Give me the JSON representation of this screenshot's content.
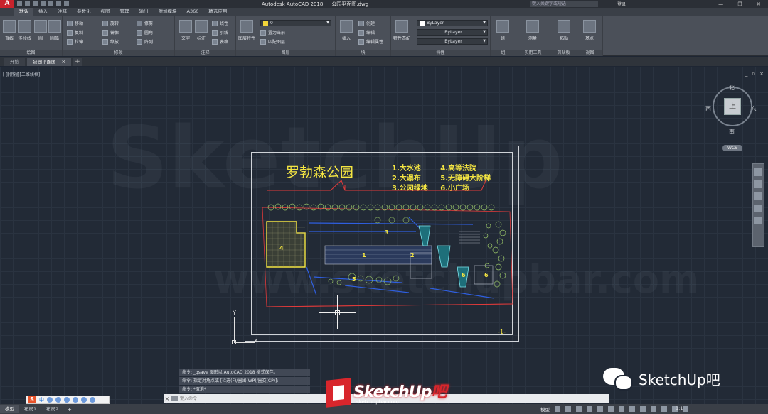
{
  "titlebar": {
    "app_icon": "A",
    "app_name": "Autodesk AutoCAD 2018",
    "file_name": "公园平面图.dwg",
    "search_placeholder": "键入关键字或短语",
    "signin": "登录"
  },
  "ribbon_tabs": [
    "默认",
    "插入",
    "注释",
    "参数化",
    "视图",
    "管理",
    "输出",
    "附加模块",
    "A360",
    "精选应用"
  ],
  "ribbon": {
    "draw": {
      "title": "绘图",
      "line": "直线",
      "polyline": "多段线",
      "circle": "圆",
      "arc": "圆弧"
    },
    "modify": {
      "title": "修改",
      "move": "移动",
      "rotate": "旋转",
      "trim": "修剪",
      "copy": "复制",
      "mirror": "镜像",
      "fillet": "圆角",
      "stretch": "拉伸",
      "scale": "缩放",
      "array": "阵列"
    },
    "annotation": {
      "title": "注释",
      "text": "文字",
      "dimension": "标注",
      "linear": "线性",
      "leader": "引线",
      "table": "表格"
    },
    "layers": {
      "title": "图层",
      "layer_props": "图层特性",
      "current_layer": "0",
      "make_current": "置为当前",
      "match_layer": "匹配图层"
    },
    "block": {
      "title": "块",
      "insert": "插入",
      "create": "创建",
      "edit": "编辑",
      "edit_attr": "编辑属性"
    },
    "properties": {
      "title": "特性",
      "match": "特性匹配",
      "color": "ByLayer",
      "linetype": "ByLayer",
      "lineweight": "ByLayer"
    },
    "groups": {
      "title": "组",
      "group": "组"
    },
    "utilities": {
      "title": "实用工具",
      "measure": "测量"
    },
    "clipboard": {
      "title": "剪贴板",
      "paste": "粘贴"
    },
    "view": {
      "title": "视图",
      "base": "基点"
    }
  },
  "file_tabs": {
    "start": "开始",
    "drawing": "公园平面图",
    "close_glyph": "×",
    "new_tab": "+"
  },
  "viewport": {
    "label": "[-][俯视][二维线框]",
    "controls": [
      "_",
      "▫",
      "×"
    ],
    "watermark_brand": "SketchUp",
    "watermark_url": "www.sketchupbar.com"
  },
  "drawing": {
    "park_title": "罗勃森公园",
    "legend_left": [
      "1.大水池",
      "2.大瀑布",
      "3.公园绿地"
    ],
    "legend_right": [
      "4.高等法院",
      "5.无障碍大阶梯",
      "6.小广场"
    ],
    "sheet_number": "-1-",
    "area_labels": [
      "4",
      "1",
      "2",
      "3",
      "5",
      "6",
      "6"
    ]
  },
  "viewcube": {
    "north": "北",
    "south": "南",
    "west": "西",
    "east": "东",
    "face": "上",
    "wcs": "WCS"
  },
  "ucs": {
    "y": "Y",
    "x": "X"
  },
  "command_history": [
    "命令: _qsave 图形以 AutoCAD 2018 格式保存。",
    "命令: 指定对角点或 [栏选(F)/圈围(WP)/圈交(CP)]:",
    "命令: *取消*"
  ],
  "command_line": {
    "placeholder": "键入命令",
    "close": "×"
  },
  "layout_tabs": [
    "模型",
    "布局1",
    "布局2"
  ],
  "status": {
    "model": "模型",
    "scale": "1:1"
  },
  "ime": {
    "logo": "S",
    "lang": "中"
  },
  "logo": {
    "brand_a": "SketchUp",
    "brand_b": "吧",
    "url": "sketchupbar.com"
  },
  "wechat": {
    "label": "SketchUp吧"
  },
  "colors": {
    "drawing_yellow": "#f4e542",
    "cad_bg": "#222a36",
    "brand_red": "#d8262c"
  }
}
